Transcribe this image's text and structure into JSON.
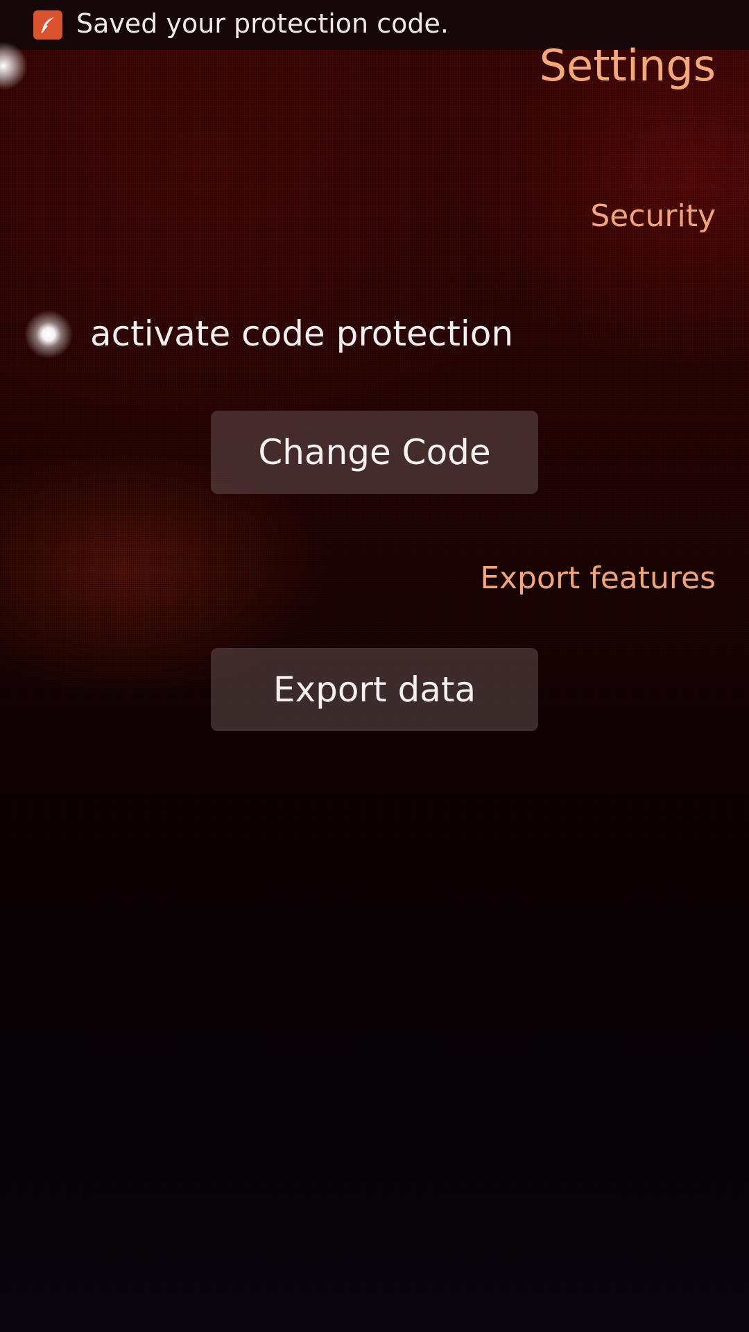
{
  "notification": {
    "icon": "feather-app-icon",
    "message": "Saved your protection code."
  },
  "page": {
    "title": "Settings"
  },
  "security": {
    "header": "Security",
    "code_protection_label": "activate code protection",
    "code_protection_enabled": true,
    "change_code_label": "Change Code"
  },
  "export": {
    "header": "Export features",
    "export_data_label": "Export data"
  },
  "colors": {
    "accent": "#f4a97a",
    "notification_icon_bg": "#d9532e"
  }
}
